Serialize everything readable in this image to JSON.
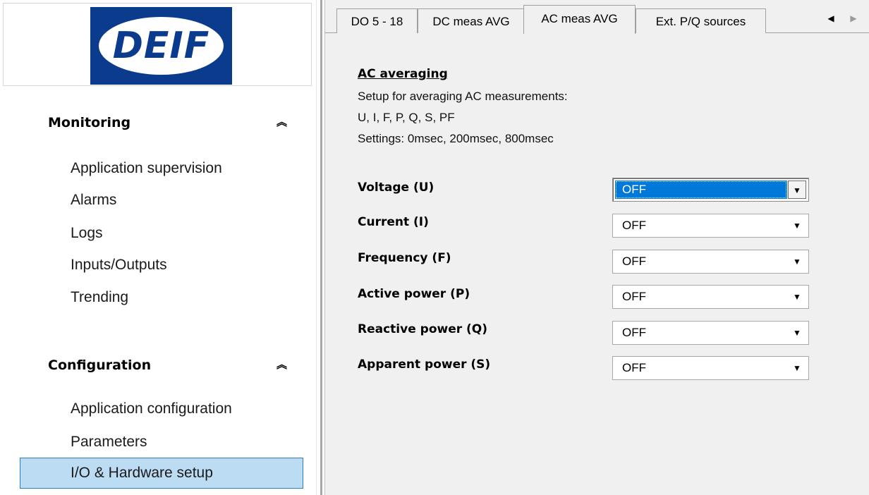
{
  "branding": {
    "logo_text": "DEIF",
    "brand_color": "#0b3b8c"
  },
  "sidebar": {
    "monitoring": {
      "heading": "Monitoring",
      "collapse_glyph": "︽",
      "items": [
        {
          "label": "Application supervision"
        },
        {
          "label": "Alarms"
        },
        {
          "label": "Logs"
        },
        {
          "label": "Inputs/Outputs"
        },
        {
          "label": "Trending"
        }
      ]
    },
    "configuration": {
      "heading": "Configuration",
      "collapse_glyph": "︽",
      "items": [
        {
          "label": "Application configuration"
        },
        {
          "label": "Parameters"
        },
        {
          "label": "I/O & Hardware setup",
          "selected": true
        }
      ]
    },
    "selected_color": "#bcdcf4"
  },
  "tabs": {
    "items": [
      {
        "label": "DO 5 - 18"
      },
      {
        "label": "DC meas AVG"
      },
      {
        "label": "AC meas AVG",
        "active": true
      },
      {
        "label": "Ext. P/Q sources"
      }
    ],
    "scroll_left_icon": "◀",
    "scroll_right_icon": "▶"
  },
  "content": {
    "title": "AC averaging",
    "description": [
      "Setup for averaging AC measurements:",
      "U, I, F, P, Q, S, PF",
      "Settings: 0msec, 200msec, 800msec"
    ],
    "dropdown_icon": "▼",
    "settings": [
      {
        "label": "Voltage (U)",
        "value": "OFF",
        "focused": true
      },
      {
        "label": "Current (I)",
        "value": "OFF"
      },
      {
        "label": "Frequency (F)",
        "value": "OFF"
      },
      {
        "label": "Active power (P)",
        "value": "OFF"
      },
      {
        "label": "Reactive power (Q)",
        "value": "OFF"
      },
      {
        "label": "Apparent power (S)",
        "value": "OFF"
      }
    ],
    "focus_color": "#0078d7"
  }
}
